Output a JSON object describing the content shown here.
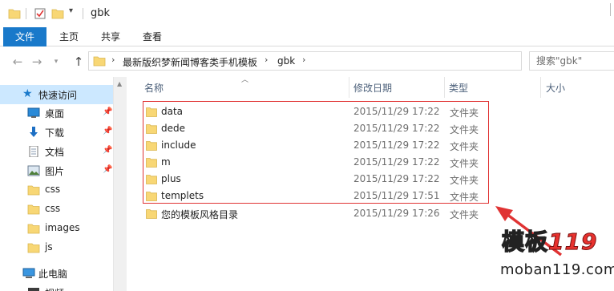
{
  "window": {
    "title": "gbk"
  },
  "ribbon": {
    "tabs": [
      "文件",
      "主页",
      "共享",
      "查看"
    ]
  },
  "address": {
    "crumbs": [
      "最新版织梦新闻博客类手机模板",
      "gbk"
    ],
    "search_placeholder": "搜索\"gbk\""
  },
  "sidebar": {
    "quick_access_label": "快速访问",
    "items": [
      {
        "label": "桌面",
        "icon": "desktop-icon",
        "pinned": true
      },
      {
        "label": "下载",
        "icon": "download-icon",
        "pinned": true
      },
      {
        "label": "文档",
        "icon": "document-icon",
        "pinned": true
      },
      {
        "label": "图片",
        "icon": "picture-icon",
        "pinned": true
      },
      {
        "label": "css",
        "icon": "folder-icon",
        "pinned": false
      },
      {
        "label": "css",
        "icon": "folder-icon",
        "pinned": false
      },
      {
        "label": "images",
        "icon": "folder-icon",
        "pinned": false
      },
      {
        "label": "js",
        "icon": "folder-icon",
        "pinned": false
      }
    ],
    "this_pc_label": "此电脑",
    "partial_label": "视频"
  },
  "columns": {
    "name": "名称",
    "date": "修改日期",
    "type": "类型",
    "size": "大小"
  },
  "files": [
    {
      "name": "data",
      "date": "2015/11/29 17:22",
      "type": "文件夹"
    },
    {
      "name": "dede",
      "date": "2015/11/29 17:22",
      "type": "文件夹"
    },
    {
      "name": "include",
      "date": "2015/11/29 17:22",
      "type": "文件夹"
    },
    {
      "name": "m",
      "date": "2015/11/29 17:22",
      "type": "文件夹"
    },
    {
      "name": "plus",
      "date": "2015/11/29 17:22",
      "type": "文件夹"
    },
    {
      "name": "templets",
      "date": "2015/11/29 17:51",
      "type": "文件夹"
    },
    {
      "name": "您的模板风格目录",
      "date": "2015/11/29 17:26",
      "type": "文件夹"
    }
  ],
  "watermark": {
    "logo_text": "模板",
    "logo_number": "119",
    "url": "moban119.com"
  },
  "colors": {
    "accent": "#1979ca",
    "selection": "#cce8ff",
    "folder": "#f8d775",
    "annotation": "#e03333"
  }
}
